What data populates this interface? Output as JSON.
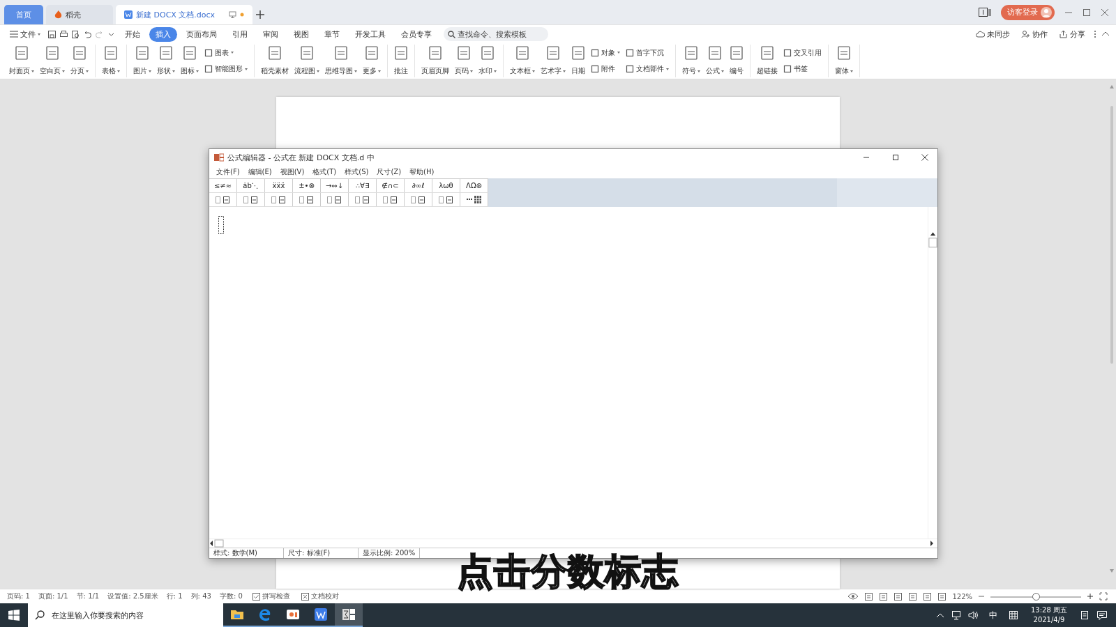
{
  "tabs": [
    {
      "label": "首页",
      "kind": "home",
      "selected": false
    },
    {
      "label": "稻壳",
      "kind": "app",
      "selected": false
    },
    {
      "label": "新建 DOCX 文档.docx",
      "kind": "doc",
      "selected": true
    }
  ],
  "account": {
    "label": "访客登录"
  },
  "menu": {
    "file": "文件",
    "tabs": [
      {
        "label": "开始",
        "selected": false
      },
      {
        "label": "插入",
        "selected": true
      },
      {
        "label": "页面布局",
        "selected": false
      },
      {
        "label": "引用",
        "selected": false
      },
      {
        "label": "审阅",
        "selected": false
      },
      {
        "label": "视图",
        "selected": false
      },
      {
        "label": "章节",
        "selected": false
      },
      {
        "label": "开发工具",
        "selected": false
      },
      {
        "label": "会员专享",
        "selected": false
      }
    ],
    "search": {
      "placeholder": "查找命令、搜索模板"
    },
    "actions": [
      "未同步",
      "协作",
      "分享"
    ]
  },
  "ribbon": [
    [
      {
        "kind": "large",
        "label": "封面页",
        "dropdown": true
      },
      {
        "kind": "large",
        "label": "空白页",
        "dropdown": true
      },
      {
        "kind": "large",
        "label": "分页",
        "dropdown": true
      }
    ],
    [
      {
        "kind": "large",
        "label": "表格",
        "dropdown": true
      }
    ],
    [
      {
        "kind": "large",
        "label": "图片",
        "dropdown": true
      },
      {
        "kind": "large",
        "label": "形状",
        "dropdown": true
      },
      {
        "kind": "large",
        "label": "图标",
        "dropdown": true
      },
      {
        "kind": "stack",
        "items": [
          {
            "label": "图表",
            "dropdown": true
          },
          {
            "label": "智能图形",
            "dropdown": true
          }
        ]
      }
    ],
    [
      {
        "kind": "large",
        "label": "稻壳素材",
        "dropdown": false
      },
      {
        "kind": "large",
        "label": "流程图",
        "dropdown": true
      },
      {
        "kind": "large",
        "label": "思维导图",
        "dropdown": true
      },
      {
        "kind": "large",
        "label": "更多",
        "dropdown": true
      }
    ],
    [
      {
        "kind": "large",
        "label": "批注",
        "dropdown": false
      }
    ],
    [
      {
        "kind": "large",
        "label": "页眉页脚",
        "dropdown": false
      },
      {
        "kind": "large",
        "label": "页码",
        "dropdown": true
      },
      {
        "kind": "large",
        "label": "水印",
        "dropdown": true
      }
    ],
    [
      {
        "kind": "large",
        "label": "文本框",
        "dropdown": true
      },
      {
        "kind": "large",
        "label": "艺术字",
        "dropdown": true
      },
      {
        "kind": "large",
        "label": "日期",
        "dropdown": false
      },
      {
        "kind": "stack",
        "items": [
          {
            "label": "对象",
            "dropdown": true
          },
          {
            "label": "附件",
            "dropdown": false
          }
        ]
      },
      {
        "kind": "stack",
        "items": [
          {
            "label": "首字下沉",
            "dropdown": false
          },
          {
            "label": "文档部件",
            "dropdown": true
          }
        ]
      }
    ],
    [
      {
        "kind": "large",
        "label": "符号",
        "dropdown": true
      },
      {
        "kind": "large",
        "label": "公式",
        "dropdown": true
      },
      {
        "kind": "large",
        "label": "编号",
        "dropdown": false
      }
    ],
    [
      {
        "kind": "large",
        "label": "超链接",
        "dropdown": false
      },
      {
        "kind": "stack",
        "items": [
          {
            "label": "交叉引用",
            "dropdown": false
          },
          {
            "label": "书签",
            "dropdown": false
          }
        ]
      }
    ],
    [
      {
        "kind": "large",
        "label": "窗体",
        "dropdown": true
      }
    ]
  ],
  "editor": {
    "title": "公式编辑器 - 公式在 新建 DOCX 文档.d 中",
    "menu": [
      "文件(F)",
      "编辑(E)",
      "视图(V)",
      "格式(T)",
      "样式(S)",
      "尺寸(Z)",
      "帮助(H)"
    ],
    "symbols": [
      "≤≠≈",
      "ȧb⋱",
      "ẍẍẍ",
      "±•⊗",
      "→⇔↓",
      "∴∀∃",
      "∉∩⊂",
      "∂∞ℓ",
      "λωθ",
      "ΛΩ⊛"
    ],
    "status": [
      "样式: 数学(M)",
      "尺寸: 标准(F)",
      "显示比例: 200%"
    ]
  },
  "caption": "点击分数标志",
  "status_bar": {
    "fields": [
      "页码: 1",
      "页面: 1/1",
      "节: 1/1",
      "设置值: 2.5厘米",
      "行: 1",
      "列: 43",
      "字数: 0"
    ],
    "checks": [
      "拼写检查",
      "文档校对"
    ],
    "zoom": "122%",
    "zoom_slider": {
      "level": 0.5
    }
  },
  "taskbar": {
    "search": {
      "placeholder": "在这里输入你要搜索的内容"
    },
    "ime": "中",
    "time": "13:28 周五",
    "date": "2021/4/9"
  }
}
